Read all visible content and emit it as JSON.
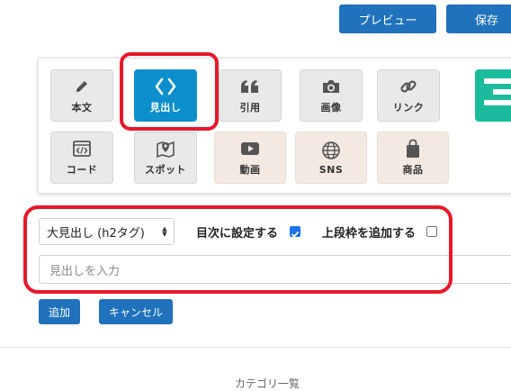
{
  "toolbar": {
    "preview_label": "プレビュー",
    "save_label": "保存"
  },
  "blocks": {
    "row1": [
      {
        "label": "本文",
        "icon": "pencil-icon"
      },
      {
        "label": "見出し",
        "icon": "code-brackets-icon",
        "active": true
      },
      {
        "label": "引用",
        "icon": "quote-icon"
      },
      {
        "label": "画像",
        "icon": "camera-icon"
      },
      {
        "label": "リンク",
        "icon": "link-icon"
      }
    ],
    "row2": [
      {
        "label": "コード",
        "icon": "code-window-icon"
      },
      {
        "label": "スポット",
        "icon": "map-pin-icon"
      },
      {
        "label": "動画",
        "icon": "play-icon"
      },
      {
        "label": "SNS",
        "icon": "globe-icon"
      },
      {
        "label": "商品",
        "icon": "shopping-bag-icon"
      }
    ]
  },
  "heading_form": {
    "level_select_value": "大見出し (h2タグ)",
    "toc_label": "目次に設定する",
    "toc_checked": true,
    "top_frame_label": "上段枠を追加する",
    "top_frame_checked": false,
    "input_placeholder": "見出しを入力",
    "add_label": "追加",
    "cancel_label": "キャンセル"
  },
  "footer": {
    "category_list_label": "カテゴリ一覧"
  },
  "colors": {
    "accent_blue": "#1f72bb",
    "active_tile": "#0d8fcc",
    "highlight_red": "#e8182a",
    "teal_tile": "#1bbc9b"
  }
}
